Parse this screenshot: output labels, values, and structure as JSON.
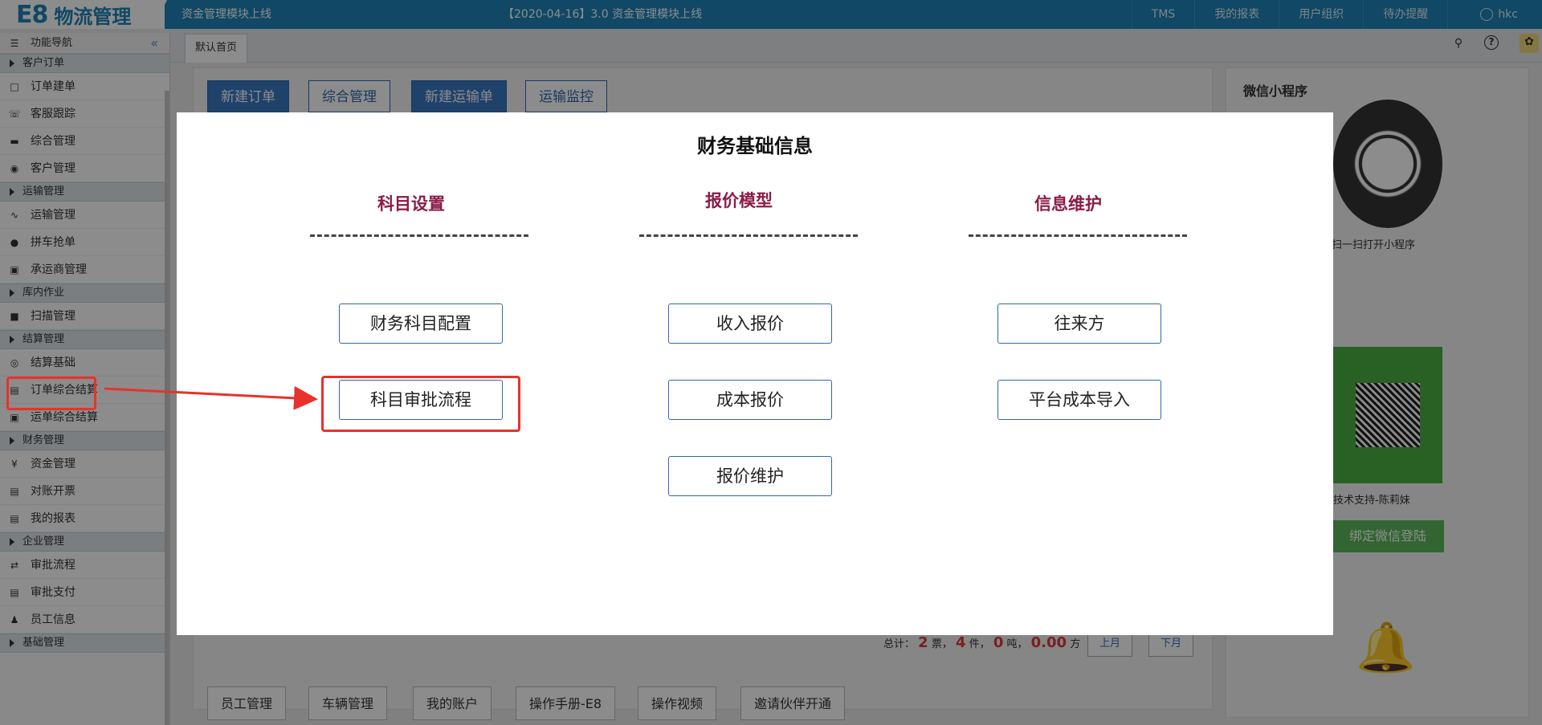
{
  "header": {
    "logo_e8": "E8",
    "logo_text": "物流管理",
    "announcement_left": "资金管理模块上线",
    "announcement_center": "【2020-04-16】3.0 资金管理模块上线",
    "nav": [
      {
        "label": "TMS"
      },
      {
        "label": "我的报表"
      },
      {
        "label": "用户组织"
      },
      {
        "label": "待办提醒"
      }
    ],
    "user": "hkc",
    "colors": {
      "bar": "#1e84b8"
    }
  },
  "sidebar": {
    "title": "功能导航",
    "collapse_icon": "«",
    "groups": [
      {
        "label": "客户订单",
        "items": [
          {
            "label": "订单建单",
            "icon": "clipboard-icon"
          },
          {
            "label": "客服跟踪",
            "icon": "phone-icon"
          },
          {
            "label": "综合管理",
            "icon": "monitor-icon"
          },
          {
            "label": "客户管理",
            "icon": "user-circle-icon"
          }
        ]
      },
      {
        "label": "运输管理",
        "items": [
          {
            "label": "运输管理",
            "icon": "route-icon"
          },
          {
            "label": "拼车抢单",
            "icon": "map-pin-icon"
          },
          {
            "label": "承运商管理",
            "icon": "truck-icon"
          }
        ]
      },
      {
        "label": "库内作业",
        "items": [
          {
            "label": "扫描管理",
            "icon": "box-icon"
          }
        ]
      },
      {
        "label": "结算管理",
        "items": [
          {
            "label": "结算基础",
            "icon": "eye-icon"
          },
          {
            "label": "订单综合结算",
            "icon": "document-icon"
          },
          {
            "label": "运单综合结算",
            "icon": "truck-icon"
          }
        ]
      },
      {
        "label": "财务管理",
        "items": [
          {
            "label": "资金管理",
            "icon": "yen-icon"
          },
          {
            "label": "对账开票",
            "icon": "document-icon"
          },
          {
            "label": "我的报表",
            "icon": "document-icon"
          }
        ]
      },
      {
        "label": "企业管理",
        "items": [
          {
            "label": "审批流程",
            "icon": "shuffle-icon"
          },
          {
            "label": "审批支付",
            "icon": "document-icon"
          },
          {
            "label": "员工信息",
            "icon": "person-icon"
          }
        ]
      },
      {
        "label": "基础管理",
        "items": []
      }
    ]
  },
  "tabs": {
    "default_tab": "默认首页"
  },
  "main": {
    "top_buttons": [
      "新建订单",
      "综合管理",
      "新建运输单",
      "运输监控"
    ],
    "totals": {
      "prefix": "总计：",
      "tickets": "2",
      "tickets_unit": "票，",
      "pieces": "4",
      "pieces_unit": "件，",
      "tons": "0",
      "tons_unit": "吨，",
      "cubic": "0.00",
      "cubic_unit": "方"
    },
    "prev_month": "上月",
    "next_month": "下月",
    "bottom_buttons": [
      "员工管理",
      "车辆管理",
      "我的账户",
      "操作手册-E8",
      "操作视频",
      "邀请伙伴开通"
    ]
  },
  "right_panel": {
    "title": "微信小程序",
    "qr1_caption": "扫一扫打开小程序",
    "qr2_caption": "技术支持-陈莉妹",
    "bind_button": "绑定微信登陆"
  },
  "modal": {
    "title": "财务基础信息",
    "columns": [
      {
        "title": "科目设置",
        "buttons": [
          "财务科目配置",
          "科目审批流程"
        ]
      },
      {
        "title": "报价模型",
        "buttons": [
          "收入报价",
          "成本报价",
          "报价维护"
        ]
      },
      {
        "title": "信息维护",
        "buttons": [
          "往来方",
          "平台成本导入"
        ]
      }
    ]
  },
  "annotation_colors": {
    "highlight": "#e8322b"
  }
}
